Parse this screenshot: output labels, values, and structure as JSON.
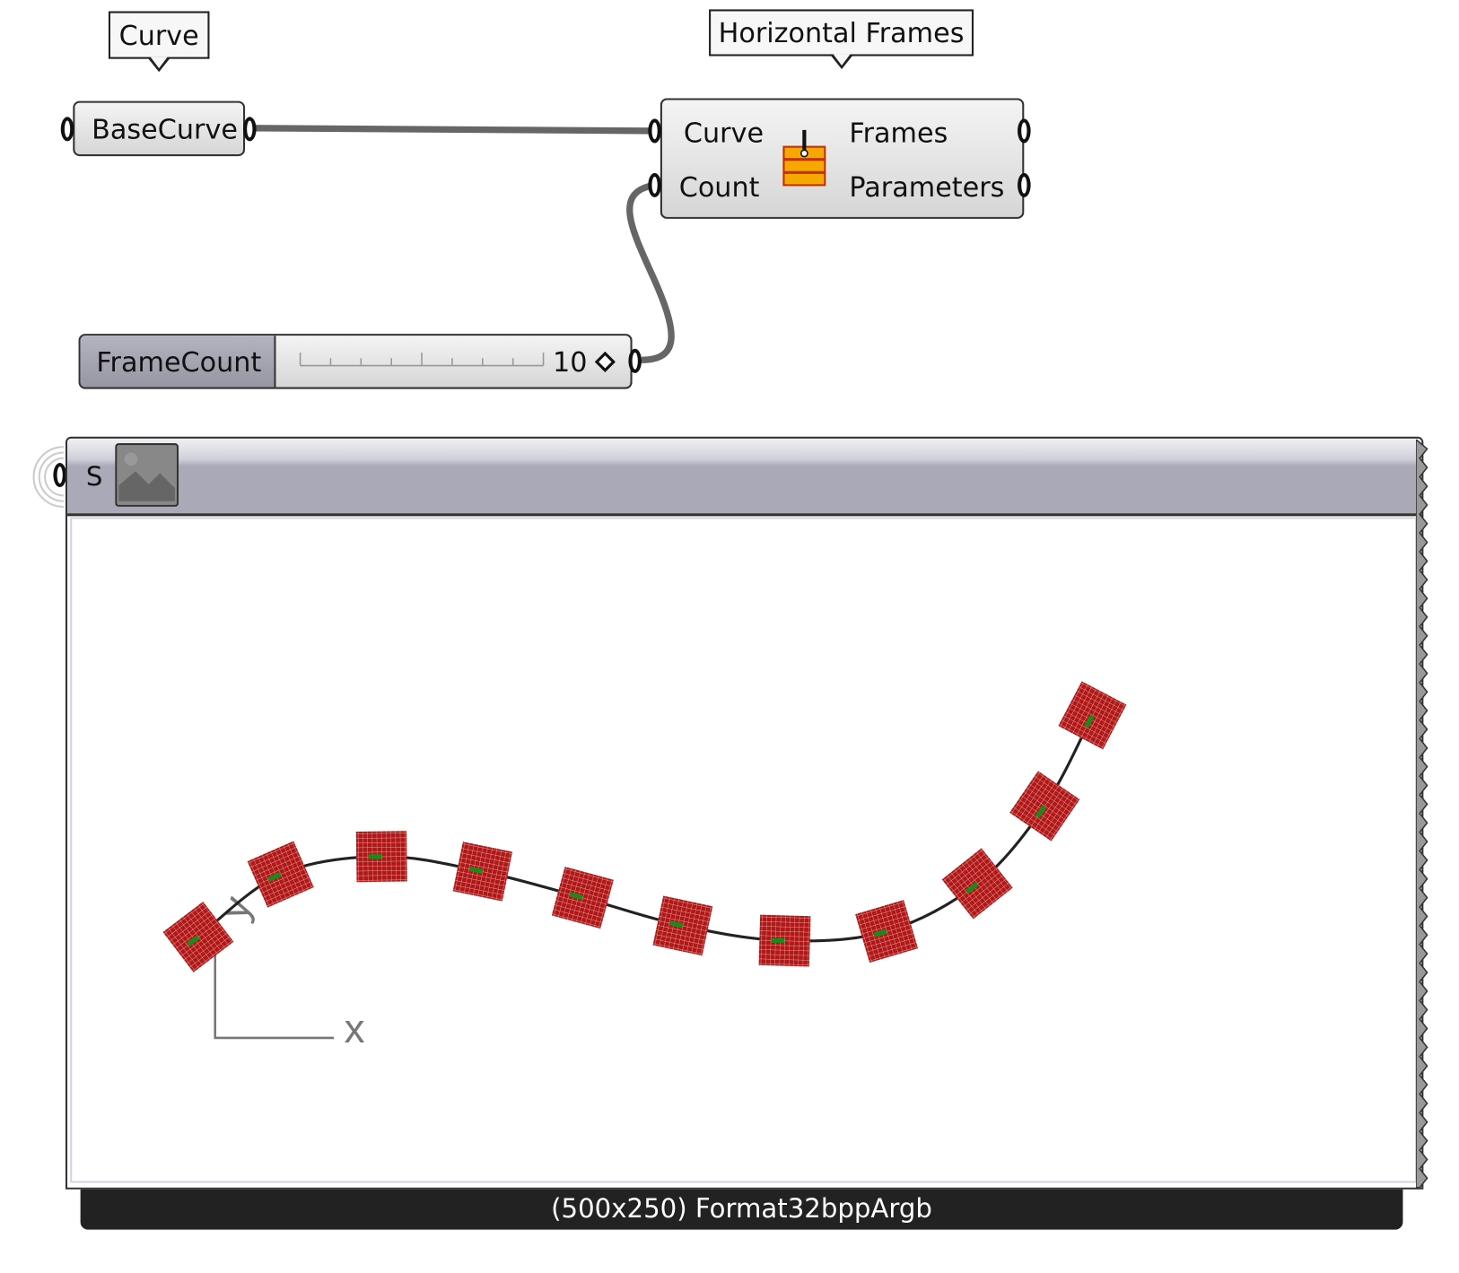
{
  "tooltips": {
    "curve": "Curve",
    "horizontal_frames": "Horizontal Frames"
  },
  "base_curve": {
    "label": "BaseCurve"
  },
  "component": {
    "inputs": [
      "Curve",
      "Count"
    ],
    "outputs": [
      "Frames",
      "Parameters"
    ],
    "icon": "horizontal-frames-icon",
    "icon_color": "#f5a800"
  },
  "slider": {
    "label": "FrameCount",
    "value": "10",
    "value_fraction": 0.1
  },
  "image_panel": {
    "input_label": "S",
    "footer": "(500x250) Format32bppArgb",
    "axis_x": "x",
    "axis_y": "y",
    "frame_count": 11,
    "frame_color": "#b01818",
    "frame_axis_color": "#1a8a1a"
  },
  "colors": {
    "wire": "#666666",
    "panel_header": "#a9a9b7",
    "footer": "#222222"
  }
}
